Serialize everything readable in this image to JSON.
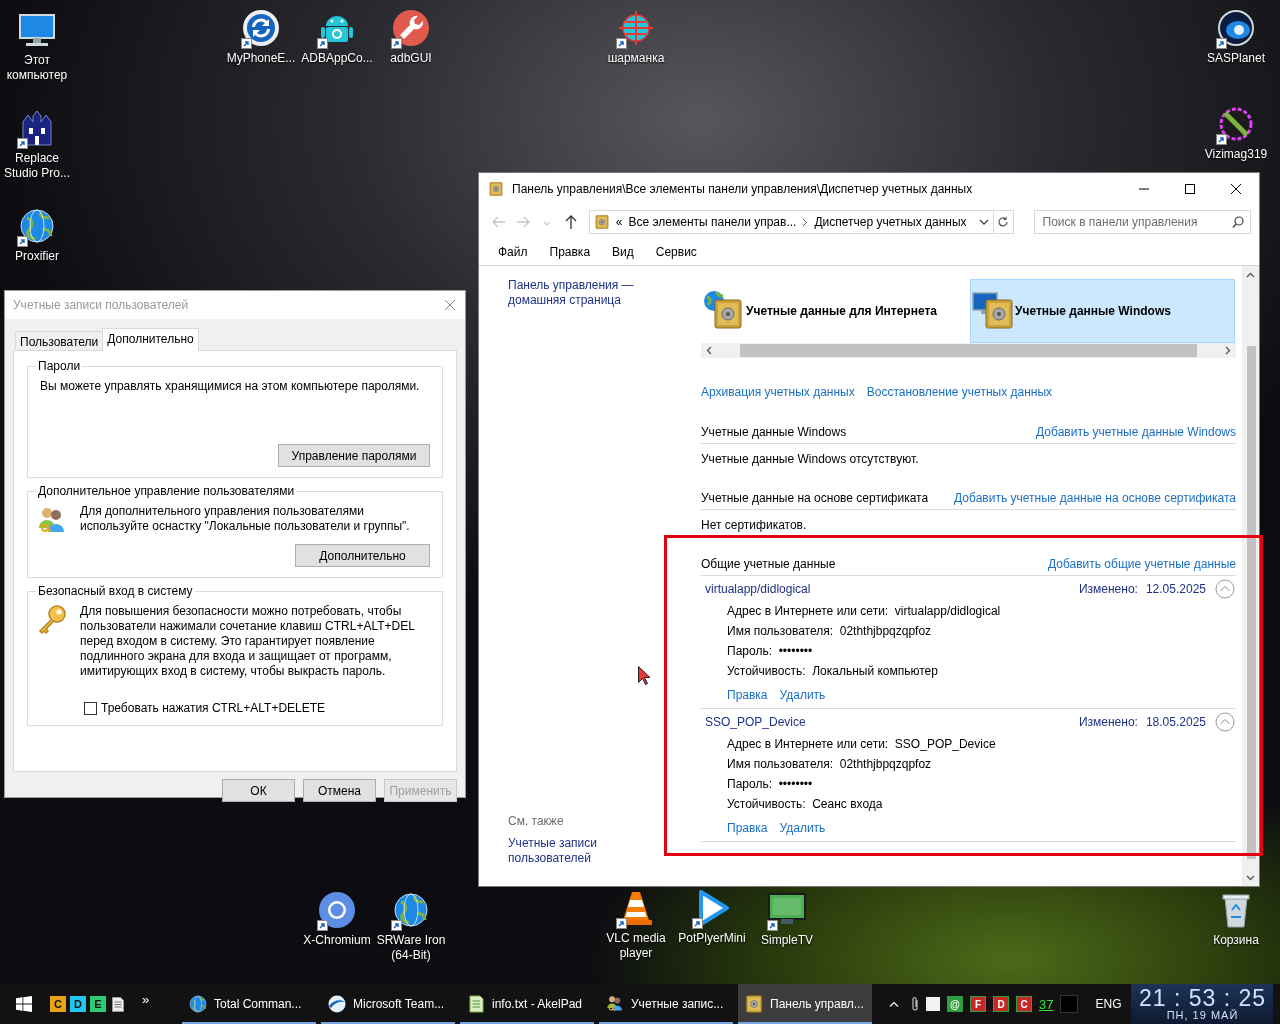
{
  "desktop_icons": [
    {
      "label": "Этот компьютер",
      "kind": "computer",
      "shortcut": false
    },
    {
      "label": "Replace Studio Pro...",
      "kind": "castle",
      "shortcut": true
    },
    {
      "label": "Proxifier",
      "kind": "globe",
      "shortcut": true
    },
    {
      "label": "MyPhoneE...",
      "kind": "sync",
      "shortcut": true
    },
    {
      "label": "ADBAppCo...",
      "kind": "robot",
      "shortcut": true
    },
    {
      "label": "adbGUI",
      "kind": "wrench",
      "shortcut": true
    },
    {
      "label": "шарманка",
      "kind": "crosshair",
      "shortcut": true
    },
    {
      "label": "SASPlanet",
      "kind": "planet",
      "shortcut": true
    },
    {
      "label": "Vizimag319",
      "kind": "crossedring",
      "shortcut": true
    },
    {
      "label": "X-Chromium",
      "kind": "ring",
      "shortcut": true
    },
    {
      "label": "SRWare Iron (64-Bit)",
      "kind": "globe",
      "shortcut": true
    },
    {
      "label": "VLC media player",
      "kind": "cone",
      "shortcut": true
    },
    {
      "label": "PotPlyerMini",
      "kind": "play",
      "shortcut": true
    },
    {
      "label": "SimpleTV",
      "kind": "tv",
      "shortcut": true
    },
    {
      "label": "Корзина",
      "kind": "bin",
      "shortcut": false
    }
  ],
  "user_accounts_dialog": {
    "title": "Учетные записи пользователей",
    "tabs": [
      {
        "label": "Пользователи",
        "selected": false
      },
      {
        "label": "Дополнительно",
        "selected": true
      }
    ],
    "groups": [
      {
        "title": "Пароли",
        "kind": "passwords",
        "text": "Вы можете управлять хранящимися на этом компьютере паролями.",
        "button": "Управление паролями"
      },
      {
        "title": "Дополнительное управление пользователями",
        "kind": "users",
        "text": "Для дополнительного управления пользователями используйте оснастку \"Локальные пользователи и группы\".",
        "button": "Дополнительно"
      },
      {
        "title": "Безопасный вход в систему",
        "kind": "secure",
        "text": "Для повышения безопасности можно потребовать, чтобы пользователи нажимали сочетание клавиш CTRL+ALT+DEL перед входом в систему. Это гарантирует появление подлинного экрана для входа и защищает от программ, имитирующих вход в систему, чтобы выкрасть пароль.",
        "checkbox": {
          "label": "Требовать нажатия CTRL+ALT+DELETE",
          "checked": false
        }
      }
    ],
    "buttons": [
      {
        "label": "ОК",
        "disabled": false
      },
      {
        "label": "Отмена",
        "disabled": false
      },
      {
        "label": "Применить",
        "disabled": true
      }
    ]
  },
  "credential_manager": {
    "title": "Панель управления\\Все элементы панели управления\\Диспетчер учетных данных",
    "nav_buttons": [
      {
        "kind": "back",
        "disabled": true
      },
      {
        "kind": "forward",
        "disabled": true
      },
      {
        "kind": "recent",
        "disabled": true
      },
      {
        "kind": "up",
        "disabled": false
      }
    ],
    "address": {
      "overflow": "«",
      "segments": [
        "Все элементы панели управ...",
        "Диспетчер учетных данных"
      ]
    },
    "search": {
      "placeholder": "Поиск в панели управления"
    },
    "menu": [
      "Файл",
      "Правка",
      "Вид",
      "Сервис"
    ],
    "sidebar": {
      "home_link": "Панель управления — домашняя страница",
      "see_also": "См. также",
      "links": [
        "Учетные записи пользователей"
      ]
    },
    "tiles": [
      {
        "label": "Учетные данные для Интернета",
        "kind": "internet",
        "selected": false
      },
      {
        "label": "Учетные данные Windows",
        "kind": "windows",
        "selected": true
      }
    ],
    "actions": [
      "Архивация учетных данных",
      "Восстановление учетных данных"
    ],
    "sections": [
      {
        "title": "Учетные данные Windows",
        "add_link": "Добавить учетные данные Windows",
        "empty_text": "Учетные данные Windows отсутствуют.",
        "highlighted": false
      },
      {
        "title": "Учетные данные на основе сертификата",
        "add_link": "Добавить учетные данные на основе сертификата",
        "empty_text": "Нет сертификатов.",
        "highlighted": false
      },
      {
        "title": "Общие учетные данные",
        "add_link": "Добавить общие учетные данные",
        "highlighted": true,
        "items": [
          {
            "name": "virtualapp/didlogical",
            "modified_label": "Изменено:",
            "modified": "12.05.2025",
            "expanded": true,
            "fields": [
              {
                "label": "Адрес в Интернете или сети:",
                "value": "virtualapp/didlogical"
              },
              {
                "label": "Имя пользователя:",
                "value": "02ththjbpqzqpfoz"
              },
              {
                "label": "Пароль:",
                "value": "••••••••"
              },
              {
                "label": "Устойчивость:",
                "value": "Локальный компьютер"
              }
            ],
            "links": [
              "Правка",
              "Удалить"
            ]
          },
          {
            "name": "SSO_POP_Device",
            "modified_label": "Изменено:",
            "modified": "18.05.2025",
            "expanded": true,
            "fields": [
              {
                "label": "Адрес в Интернете или сети:",
                "value": "SSO_POP_Device"
              },
              {
                "label": "Имя пользователя:",
                "value": "02ththjbpqzqpfoz"
              },
              {
                "label": "Пароль:",
                "value": "••••••••"
              },
              {
                "label": "Устойчивость:",
                "value": "Сеанс входа"
              }
            ],
            "links": [
              "Правка",
              "Удалить"
            ]
          }
        ]
      }
    ]
  },
  "taskbar": {
    "quick_launch": [
      {
        "label": "C",
        "color": "#e8a317"
      },
      {
        "label": "D",
        "color": "#1ec8f0"
      },
      {
        "label": "E",
        "color": "#2ecc71"
      }
    ],
    "overflow": "»",
    "tasks": [
      {
        "label": "Total Comman...",
        "kind": "globe",
        "selected": false
      },
      {
        "label": "Microsoft Team...",
        "kind": "swoosh",
        "selected": false
      },
      {
        "label": "info.txt - AkelPad",
        "kind": "notepad",
        "selected": false
      },
      {
        "label": "Учетные запис...",
        "kind": "users",
        "selected": false
      },
      {
        "label": "Панель управл...",
        "kind": "safe",
        "selected": true
      }
    ],
    "tray": {
      "badges": [
        {
          "label": "@",
          "color": "#2e9e3e"
        },
        {
          "label": "F",
          "color": "#c62828"
        },
        {
          "label": "D",
          "color": "#c62828"
        },
        {
          "label": "C",
          "color": "#c62828"
        }
      ],
      "counter": "37",
      "language": "ENG",
      "time": "21 : 53 : 25",
      "date": "ПН, 19 МАЙ"
    }
  }
}
